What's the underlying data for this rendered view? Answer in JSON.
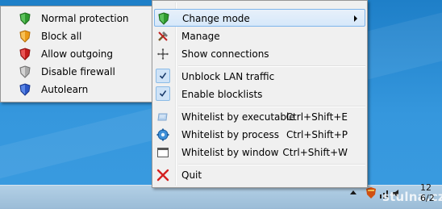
{
  "submenu": {
    "items": [
      {
        "label": "Normal protection",
        "icon": "shield-green-icon",
        "color": "#3a9b3a"
      },
      {
        "label": "Block all",
        "icon": "shield-orange-icon",
        "color": "#f0a020"
      },
      {
        "label": "Allow outgoing",
        "icon": "shield-red-icon",
        "color": "#c82020"
      },
      {
        "label": "Disable firewall",
        "icon": "shield-gray-icon",
        "color": "#a8a8a8"
      },
      {
        "label": "Autolearn",
        "icon": "shield-blue-icon",
        "color": "#2a58c8"
      }
    ]
  },
  "menu": {
    "change_mode": "Change mode",
    "manage": "Manage",
    "show_connections": "Show connections",
    "unblock_lan": "Unblock LAN traffic",
    "enable_blocklists": "Enable blocklists",
    "wl_executable": "Whitelist by executable",
    "wl_executable_sc": "Ctrl+Shift+E",
    "wl_process": "Whitelist by process",
    "wl_process_sc": "Ctrl+Shift+P",
    "wl_window": "Whitelist by window",
    "wl_window_sc": "Ctrl+Shift+W",
    "quit": "Quit"
  },
  "tray": {
    "clock_time": "12",
    "clock_date": "6/2",
    "watermark": "stulna.cz"
  },
  "colors": {
    "highlight_border": "#7eb4ea",
    "quit_icon": "#d42020"
  }
}
